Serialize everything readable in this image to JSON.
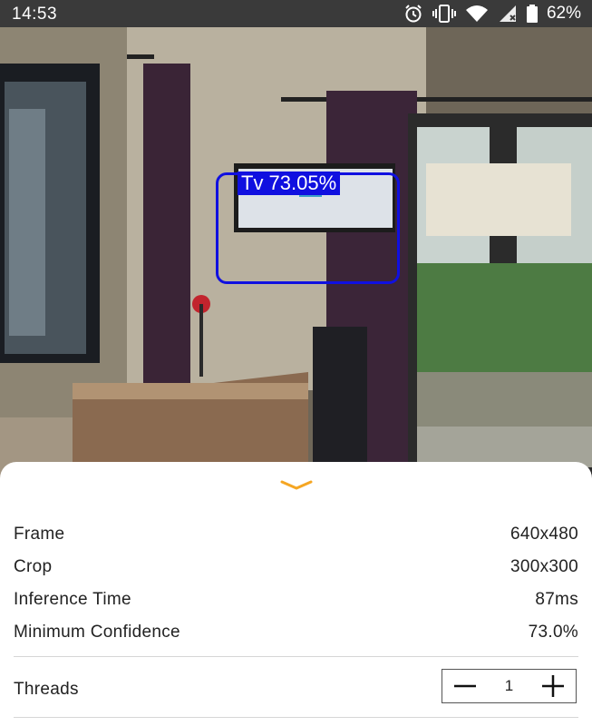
{
  "status_bar": {
    "time": "14:53",
    "battery_percent": "62%",
    "icons": [
      "alarm-icon",
      "vibrate-icon",
      "wifi-icon",
      "cell-signal-icon",
      "battery-icon"
    ]
  },
  "detection": {
    "label": "Tv 73.05%",
    "box_color": "#1010e0"
  },
  "info": {
    "frame_label": "Frame",
    "frame_value": "640x480",
    "crop_label": "Crop",
    "crop_value": "300x300",
    "inference_label": "Inference Time",
    "inference_value": "87ms",
    "confidence_label": "Minimum Confidence",
    "confidence_value": "73.0%"
  },
  "threads": {
    "label": "Threads",
    "value": "1",
    "minus_icon": "minus-icon",
    "plus_icon": "plus-icon"
  },
  "accent_color": "#f5a623"
}
